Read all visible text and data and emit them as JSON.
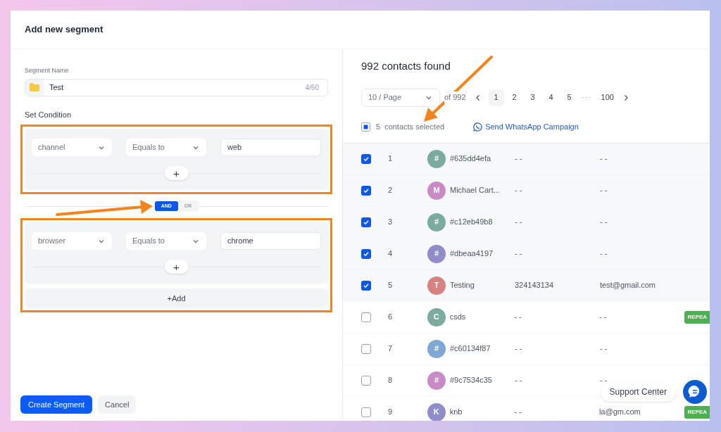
{
  "dialog": {
    "title": "Add new segment"
  },
  "segment_name": {
    "label": "Segment Name",
    "value": "Test",
    "counter": "4/60"
  },
  "condition_heading": "Set Condition",
  "condition_groups": [
    {
      "highlighted": true,
      "rules": [
        {
          "field": "channel",
          "operator": "Equals to",
          "value": "web"
        }
      ],
      "add_rule": "+"
    },
    {
      "highlighted": true,
      "rules": [
        {
          "field": "browser",
          "operator": "Equals to",
          "value": "chrome"
        }
      ],
      "add_rule": "+",
      "add_group": "+Add"
    }
  ],
  "logic_toggle": [
    {
      "label": "AND",
      "selected": true
    },
    {
      "label": "OR",
      "selected": false
    }
  ],
  "actions": [
    {
      "label": "Create Segment",
      "kind": "primary"
    },
    {
      "label": "Cancel",
      "kind": "secondary"
    }
  ],
  "results": {
    "heading": "992 contacts found",
    "page_size": "10 / Page",
    "total": "of 992",
    "pages": [
      {
        "label": "1",
        "selected": true
      },
      {
        "label": "2",
        "selected": false
      },
      {
        "label": "3",
        "selected": false
      },
      {
        "label": "4",
        "selected": false
      },
      {
        "label": "5",
        "selected": false
      }
    ],
    "ellipsis": "···",
    "last_page": "100",
    "selection": {
      "indeterminate": true,
      "count": "5",
      "label": "contacts selected",
      "campaign_link": "Send WhatsApp Campaign"
    }
  },
  "contacts": [
    {
      "checked": true,
      "index": "1",
      "initial": "#",
      "color": "#7aab9e",
      "name": "#635dd4efa",
      "phone": "- -",
      "email": "- -"
    },
    {
      "checked": true,
      "index": "2",
      "initial": "M",
      "color": "#c98bc5",
      "name": "Michael Cart...",
      "phone": "- -",
      "email": "- -"
    },
    {
      "checked": true,
      "index": "3",
      "initial": "#",
      "color": "#7aab9e",
      "name": "#c12eb49b8",
      "phone": "- -",
      "email": "- -"
    },
    {
      "checked": true,
      "index": "4",
      "initial": "#",
      "color": "#8f8cc9",
      "name": "#dbeaa4197",
      "phone": "- -",
      "email": "- -"
    },
    {
      "checked": true,
      "index": "5",
      "initial": "T",
      "color": "#d98080",
      "name": "Testing",
      "phone": "324143134",
      "email": "test@gmail.com"
    },
    {
      "checked": false,
      "index": "6",
      "initial": "C",
      "color": "#7aab9e",
      "name": "csds",
      "phone": "- -",
      "email": "- -",
      "tag": "REPEA"
    },
    {
      "checked": false,
      "index": "7",
      "initial": "#",
      "color": "#7fa8d4",
      "name": "#c60134f87",
      "phone": "- -",
      "email": "- -"
    },
    {
      "checked": false,
      "index": "8",
      "initial": "#",
      "color": "#c98bc5",
      "name": "#9c7534c35",
      "phone": "- -",
      "email": "- -"
    },
    {
      "checked": false,
      "index": "9",
      "initial": "K",
      "color": "#8f8cc9",
      "name": "knb",
      "phone": "- -",
      "email": "la@gm.com",
      "tag": "REPEA"
    }
  ],
  "support": {
    "label": "Support Center"
  }
}
